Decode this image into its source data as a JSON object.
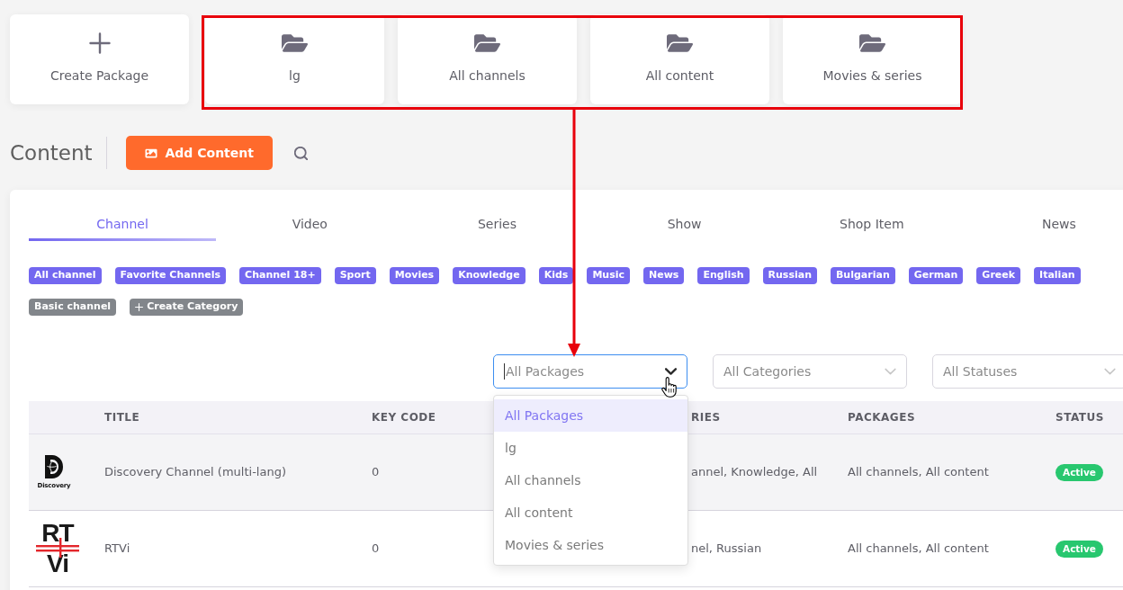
{
  "package_cards": [
    {
      "kind": "create",
      "label": "Create Package"
    },
    {
      "kind": "package",
      "label": "lg"
    },
    {
      "kind": "package",
      "label": "All channels"
    },
    {
      "kind": "package",
      "label": "All content"
    },
    {
      "kind": "package",
      "label": "Movies & series"
    }
  ],
  "content_header": {
    "title": "Content",
    "add_button": "Add Content"
  },
  "tabs": [
    {
      "label": "Channel",
      "selected": true
    },
    {
      "label": "Video",
      "selected": false
    },
    {
      "label": "Series",
      "selected": false
    },
    {
      "label": "Show",
      "selected": false
    },
    {
      "label": "Shop Item",
      "selected": false
    },
    {
      "label": "News",
      "selected": false
    }
  ],
  "tag_rows": [
    [
      {
        "kind": "category",
        "label": "All channel"
      },
      {
        "kind": "category",
        "label": "Favorite Channels"
      },
      {
        "kind": "category",
        "label": "Channel 18+"
      },
      {
        "kind": "category",
        "label": "Sport"
      },
      {
        "kind": "category",
        "label": "Movies"
      },
      {
        "kind": "category",
        "label": "Knowledge"
      },
      {
        "kind": "category",
        "label": "Kids"
      },
      {
        "kind": "category",
        "label": "Music"
      },
      {
        "kind": "category",
        "label": "News"
      },
      {
        "kind": "category",
        "label": "English"
      },
      {
        "kind": "category",
        "label": "Russian"
      },
      {
        "kind": "category",
        "label": "Bulgarian"
      },
      {
        "kind": "category",
        "label": "German"
      },
      {
        "kind": "category",
        "label": "Greek"
      },
      {
        "kind": "category",
        "label": "Italian"
      }
    ],
    [
      {
        "kind": "basic",
        "label": "Basic channel"
      },
      {
        "kind": "create",
        "label": "Create Category"
      }
    ]
  ],
  "filters": [
    {
      "value": "All Packages",
      "focused": true
    },
    {
      "value": "All Categories",
      "focused": false
    },
    {
      "value": "All Statuses",
      "focused": false
    }
  ],
  "package_menu": [
    {
      "label": "All Packages",
      "selected": true
    },
    {
      "label": "lg",
      "selected": false
    },
    {
      "label": "All channels",
      "selected": false
    },
    {
      "label": "All content",
      "selected": false
    },
    {
      "label": "Movies & series",
      "selected": false
    }
  ],
  "table": {
    "columns": [
      "TITLE",
      "KEY CODE",
      "RIES",
      "PACKAGES",
      "STATUS"
    ],
    "rows": [
      {
        "highlighted": true,
        "logo": {
          "kind": "discovery",
          "lines": [
            "Discovery"
          ]
        },
        "title": "Discovery Channel (multi-lang)",
        "key_code": "0",
        "categories": "annel, Knowledge, All",
        "packages": "All channels, All content",
        "status": "Active"
      },
      {
        "highlighted": false,
        "logo": {
          "kind": "rtvi",
          "lines": [
            "RT",
            "Vi"
          ]
        },
        "title": "RTVi",
        "key_code": "0",
        "categories": "nel, Russian",
        "packages": "All channels, All content",
        "status": "Active"
      }
    ]
  }
}
